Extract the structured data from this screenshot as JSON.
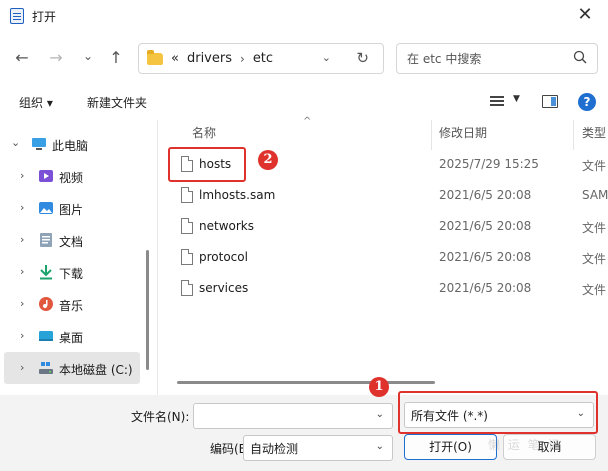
{
  "window": {
    "title": "打开",
    "close_glyph": "✕"
  },
  "nav": {
    "back_glyph": "←",
    "forward_glyph": "→",
    "recent_glyph": "⌄",
    "up_glyph": "↑",
    "address": {
      "overflow": "«",
      "crumbs": [
        "drivers",
        "etc"
      ],
      "separator": "›",
      "dropdown_glyph": "⌄",
      "refresh_glyph": "↻"
    },
    "search": {
      "placeholder": "在 etc 中搜索",
      "icon": "search-icon"
    }
  },
  "toolbar": {
    "organize_label": "组织 ▾",
    "new_folder_label": "新建文件夹",
    "view_dropdown_glyph": "▼",
    "help_glyph": "?"
  },
  "sidebar": {
    "items": [
      {
        "label": "此电脑",
        "icon": "computer-icon",
        "expanded": true
      },
      {
        "label": "视频",
        "icon": "video-icon"
      },
      {
        "label": "图片",
        "icon": "pictures-icon"
      },
      {
        "label": "文档",
        "icon": "documents-icon"
      },
      {
        "label": "下载",
        "icon": "download-icon"
      },
      {
        "label": "音乐",
        "icon": "music-icon"
      },
      {
        "label": "桌面",
        "icon": "desktop-icon"
      },
      {
        "label": "本地磁盘 (C:)",
        "icon": "drive-icon",
        "selected": true
      }
    ]
  },
  "files": {
    "columns": {
      "name": "名称",
      "modified": "修改日期",
      "type": "类型"
    },
    "sort_glyph": "^",
    "rows": [
      {
        "name": "hosts",
        "modified": "2025/7/29 15:25",
        "type": "文件"
      },
      {
        "name": "lmhosts.sam",
        "modified": "2021/6/5 20:08",
        "type": "SAM"
      },
      {
        "name": "networks",
        "modified": "2021/6/5 20:08",
        "type": "文件"
      },
      {
        "name": "protocol",
        "modified": "2021/6/5 20:08",
        "type": "文件"
      },
      {
        "name": "services",
        "modified": "2021/6/5 20:08",
        "type": "文件"
      }
    ]
  },
  "bottom": {
    "filename_label": "文件名(N):",
    "filename_value": "",
    "filter_value": "所有文件  (*.*)",
    "encoding_label": "编码(E):",
    "encoding_value": "自动检测",
    "open_button": "打开(O)",
    "cancel_button": "取消",
    "dropdown_glyph": "⌄"
  },
  "annotations": {
    "badge_1": "1",
    "badge_2": "2"
  },
  "watermark": "懒 运 笔 记",
  "colors": {
    "annotation_red": "#e0322d",
    "accent_blue": "#1f6fd0"
  }
}
